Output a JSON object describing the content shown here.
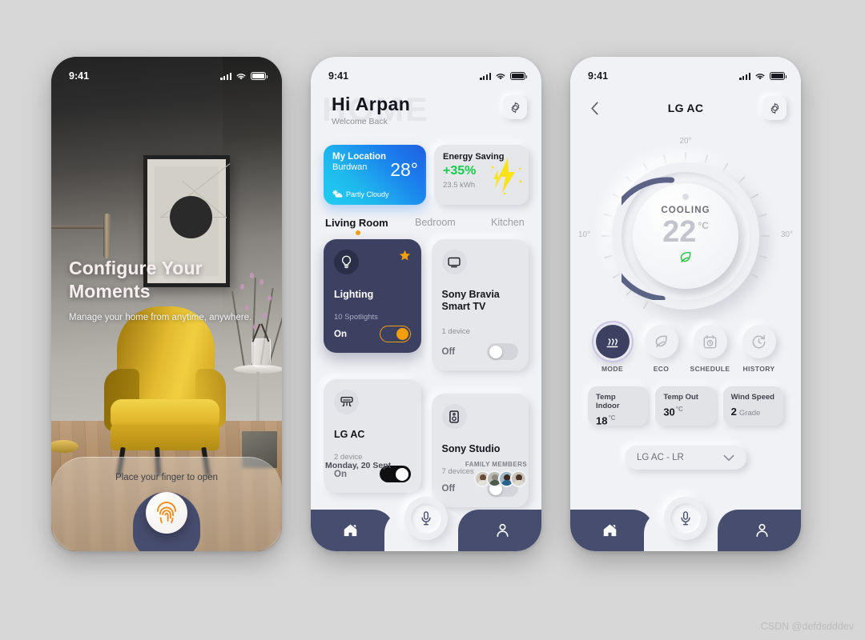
{
  "background_color": "#d7d7d7",
  "watermark": "CSDN @defdsdddev",
  "colors": {
    "accent_orange": "#f59e0b",
    "navy": "#474d6e",
    "card_navy": "#3c4161",
    "green": "#17cb4e",
    "weather_blue": "#1f5fe0",
    "weather_cyan": "#21cdf0"
  },
  "phone1": {
    "status": {
      "time": "9:41",
      "signal_icon": "signal-bars-icon",
      "wifi_icon": "wifi-icon",
      "battery_icon": "battery-icon"
    },
    "headline_line1": "Configure Your",
    "headline_line2": "Moments",
    "subtext": "Manage your home from anytime, anywhere.",
    "unlock_prompt": "Place your finger to open",
    "fingerprint_icon": "fingerprint-icon"
  },
  "phone2": {
    "status": {
      "time": "9:41",
      "signal_icon": "signal-bars-icon",
      "wifi_icon": "wifi-icon",
      "battery_icon": "battery-icon"
    },
    "watermark_text": "HOME",
    "greeting": "Hi  Arpan",
    "greeting_sub": "Welcome Back",
    "settings_icon": "gear-icon",
    "weather": {
      "title": "My Location",
      "city": "Burdwan",
      "temperature": "28°",
      "condition": "Partly Cloudy",
      "condition_icon": "sun-cloud-icon"
    },
    "energy": {
      "title": "Energy Saving",
      "percent": "+35%",
      "kwh": "23.5 kWh",
      "icon": "lightning-bolt-icon"
    },
    "tabs": [
      {
        "label": "Living Room",
        "selected": true
      },
      {
        "label": "Bedroom",
        "selected": false
      },
      {
        "label": "Kitchen",
        "selected": false
      }
    ],
    "devices": [
      {
        "name": "Lighting",
        "sub": "10 Spotlights",
        "state": "On",
        "on": true,
        "active": true,
        "favorite": true,
        "icon": "bulb-icon"
      },
      {
        "name": "Sony Bravia Smart TV",
        "sub": "1 device",
        "state": "Off",
        "on": false,
        "active": false,
        "favorite": false,
        "icon": "tv-icon"
      },
      {
        "name": "LG AC",
        "sub": "2 device",
        "state": "On",
        "on": true,
        "active": false,
        "favorite": false,
        "icon": "ac-icon"
      },
      {
        "name": "Sony Studio",
        "sub": "7 devices",
        "state": "Off",
        "on": false,
        "active": false,
        "favorite": false,
        "icon": "speaker-icon"
      }
    ],
    "date": "Monday, 20 Sept",
    "family_label": "FAMILY MEMBERS",
    "family_avatars": 4,
    "nav": [
      {
        "name": "home",
        "icon": "home-icon"
      },
      {
        "name": "voice",
        "icon": "microphone-icon"
      },
      {
        "name": "profile",
        "icon": "person-icon"
      }
    ]
  },
  "phone3": {
    "status": {
      "time": "9:41",
      "signal_icon": "signal-bars-icon",
      "wifi_icon": "wifi-icon",
      "battery_icon": "battery-icon"
    },
    "back_icon": "chevron-left-icon",
    "title": "LG AC",
    "settings_icon": "gear-icon",
    "dial": {
      "min_label": "10°",
      "max_label": "30°",
      "top_label": "20°",
      "mode": "COOLING",
      "temperature": "22",
      "unit": "°C",
      "eco_icon": "leaf-icon"
    },
    "modes": [
      {
        "label": "MODE",
        "icon": "heat-waves-icon",
        "selected": true
      },
      {
        "label": "ECO",
        "icon": "leaf-icon",
        "selected": false
      },
      {
        "label": "SCHEDULE",
        "icon": "calendar-clock-icon",
        "selected": false
      },
      {
        "label": "HISTORY",
        "icon": "clock-refresh-icon",
        "selected": false
      }
    ],
    "kpis": [
      {
        "label": "Temp Indoor",
        "value": "18",
        "unit": "°C",
        "extra": ""
      },
      {
        "label": "Temp Out",
        "value": "30",
        "unit": "°C",
        "extra": ""
      },
      {
        "label": "Wind Speed",
        "value": "2",
        "unit": "",
        "extra": "Grade"
      }
    ],
    "device_select": {
      "value": "LG AC - LR",
      "chevron_icon": "chevron-down-icon"
    },
    "nav": [
      {
        "name": "home",
        "icon": "home-icon"
      },
      {
        "name": "voice",
        "icon": "microphone-icon"
      },
      {
        "name": "profile",
        "icon": "person-icon"
      }
    ]
  }
}
